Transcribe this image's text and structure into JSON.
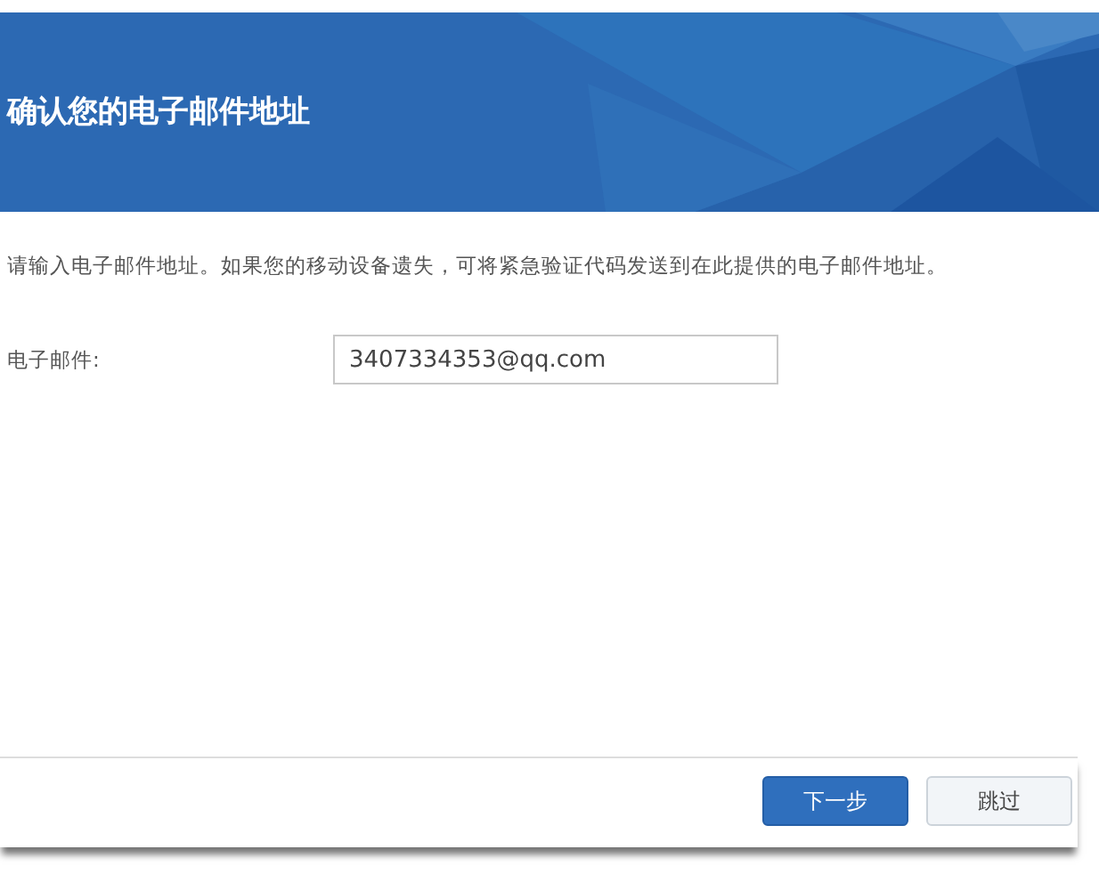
{
  "header": {
    "title": "确认您的电子邮件地址"
  },
  "description": "请输入电子邮件地址。如果您的移动设备遗失，可将紧急验证代码发送到在此提供的电子邮件地址。",
  "email_field": {
    "label": "电子邮件:",
    "value": "3407334353@qq.com"
  },
  "buttons": [
    {
      "label": "下一步",
      "kind": "primary"
    },
    {
      "label": "跳过",
      "kind": "secondary"
    }
  ]
}
